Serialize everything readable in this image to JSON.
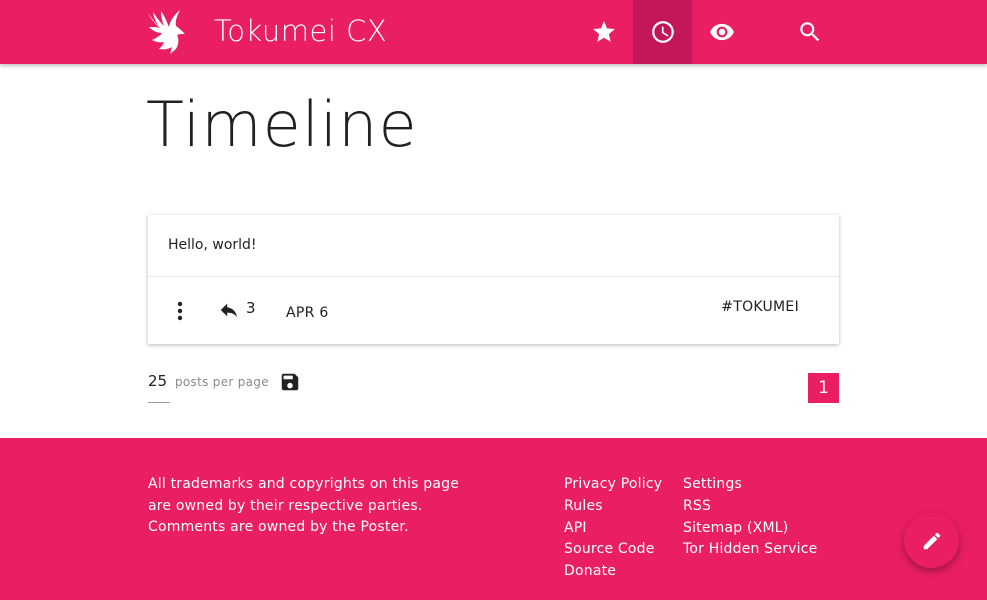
{
  "header": {
    "brand": "Tokumei CX",
    "nav": [
      {
        "icon": "star-icon",
        "active": false
      },
      {
        "icon": "clock-icon",
        "active": true
      },
      {
        "icon": "eye-icon",
        "active": false
      },
      {
        "icon": "search-icon",
        "active": false
      }
    ]
  },
  "page": {
    "title": "Timeline"
  },
  "post": {
    "text": "Hello, world!",
    "reply_count": "3",
    "date": "APR 6",
    "tag": "#TOKUMEI"
  },
  "pagination": {
    "per_page_value": "25",
    "per_page_label": "posts per page",
    "current_page": "1"
  },
  "footer": {
    "notice_lines": [
      "All trademarks and copyrights on this page",
      "are owned by their respective parties.",
      "Comments are owned by the Poster."
    ],
    "links_col1": [
      "Privacy Policy",
      "Rules",
      "API",
      "Source Code",
      "Donate"
    ],
    "links_col2": [
      "Settings",
      "RSS",
      "Sitemap (XML)",
      "Tor Hidden Service"
    ]
  },
  "colors": {
    "primary": "#e91e63",
    "primary_dark": "#c2185b",
    "text": "#212121"
  }
}
